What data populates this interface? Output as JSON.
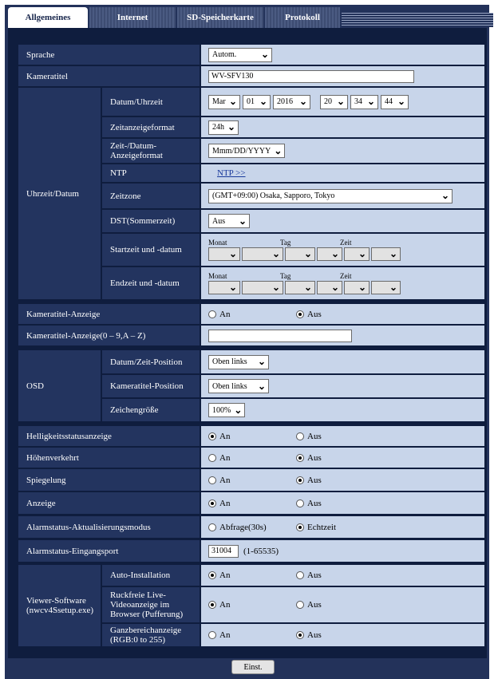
{
  "tabs": [
    {
      "label": "Allgemeines",
      "active": true
    },
    {
      "label": "Internet",
      "active": false
    },
    {
      "label": "SD-Speicherkarte",
      "active": false
    },
    {
      "label": "Protokoll",
      "active": false
    }
  ],
  "sprache": {
    "label": "Sprache",
    "value": "Autom."
  },
  "kameratitel": {
    "label": "Kameratitel",
    "value": "WV-SFV130"
  },
  "uhrzeit": {
    "group_label": "Uhrzeit/Datum",
    "datum": {
      "label": "Datum/Uhrzeit",
      "month": "Mar",
      "day": "01",
      "year": "2016",
      "hour": "20",
      "minute": "34",
      "second": "44"
    },
    "zeitanzeige": {
      "label": "Zeitanzeigeformat",
      "value": "24h"
    },
    "datumsformat": {
      "label": "Zeit-/Datum-\nAnzeigeformat",
      "value": "Mmm/DD/YYYY"
    },
    "ntp": {
      "label": "NTP",
      "link": "NTP >>"
    },
    "zeitzone": {
      "label": "Zeitzone",
      "value": "(GMT+09:00) Osaka, Sapporo, Tokyo"
    },
    "dst": {
      "label": "DST(Sommerzeit)",
      "value": "Aus"
    },
    "startzeit": {
      "label": "Startzeit und -datum",
      "monat": "Monat",
      "tag": "Tag",
      "zeit": "Zeit"
    },
    "endzeit": {
      "label": "Endzeit und -datum",
      "monat": "Monat",
      "tag": "Tag",
      "zeit": "Zeit"
    }
  },
  "kameratitel_anzeige": {
    "label": "Kameratitel-Anzeige",
    "opt1": "An",
    "opt2": "Aus",
    "selected": "Aus"
  },
  "kameratitel_anzeige_text": {
    "label": "Kameratitel-Anzeige(0 – 9,A – Z)",
    "value": ""
  },
  "osd": {
    "group_label": "OSD",
    "datum_position": {
      "label": "Datum/Zeit-Position",
      "value": "Oben links"
    },
    "titel_position": {
      "label": "Kameratitel-Position",
      "value": "Oben links"
    },
    "zeichengroesse": {
      "label": "Zeichengröße",
      "value": "100%"
    }
  },
  "helligkeit": {
    "label": "Helligkeitsstatusanzeige",
    "opt1": "An",
    "opt2": "Aus",
    "selected": "An"
  },
  "hoehenverkehrt": {
    "label": "Höhenverkehrt",
    "opt1": "An",
    "opt2": "Aus",
    "selected": "Aus"
  },
  "spiegelung": {
    "label": "Spiegelung",
    "opt1": "An",
    "opt2": "Aus",
    "selected": "Aus"
  },
  "anzeige": {
    "label": "Anzeige",
    "opt1": "An",
    "opt2": "Aus",
    "selected": "An"
  },
  "alarm_modus": {
    "label": "Alarmstatus-Aktualisierungsmodus",
    "opt1": "Abfrage(30s)",
    "opt2": "Echtzeit",
    "selected": "Echtzeit"
  },
  "alarm_port": {
    "label": "Alarmstatus-Eingangsport",
    "value": "31004",
    "range": "(1-65535)"
  },
  "viewer": {
    "group_label": "Viewer-Software\n(nwcv4Ssetup.exe)",
    "auto": {
      "label": "Auto-Installation",
      "opt1": "An",
      "opt2": "Aus",
      "selected": "An"
    },
    "ruckfrei": {
      "label": "Ruckfreie Live-\nVideoanzeige im\nBrowser (Pufferung)",
      "opt1": "An",
      "opt2": "Aus",
      "selected": "An"
    },
    "ganz": {
      "label": "Ganzbereichanzeige\n(RGB:0 to 255)",
      "opt1": "An",
      "opt2": "Aus",
      "selected": "Aus"
    }
  },
  "submit": "Einst."
}
